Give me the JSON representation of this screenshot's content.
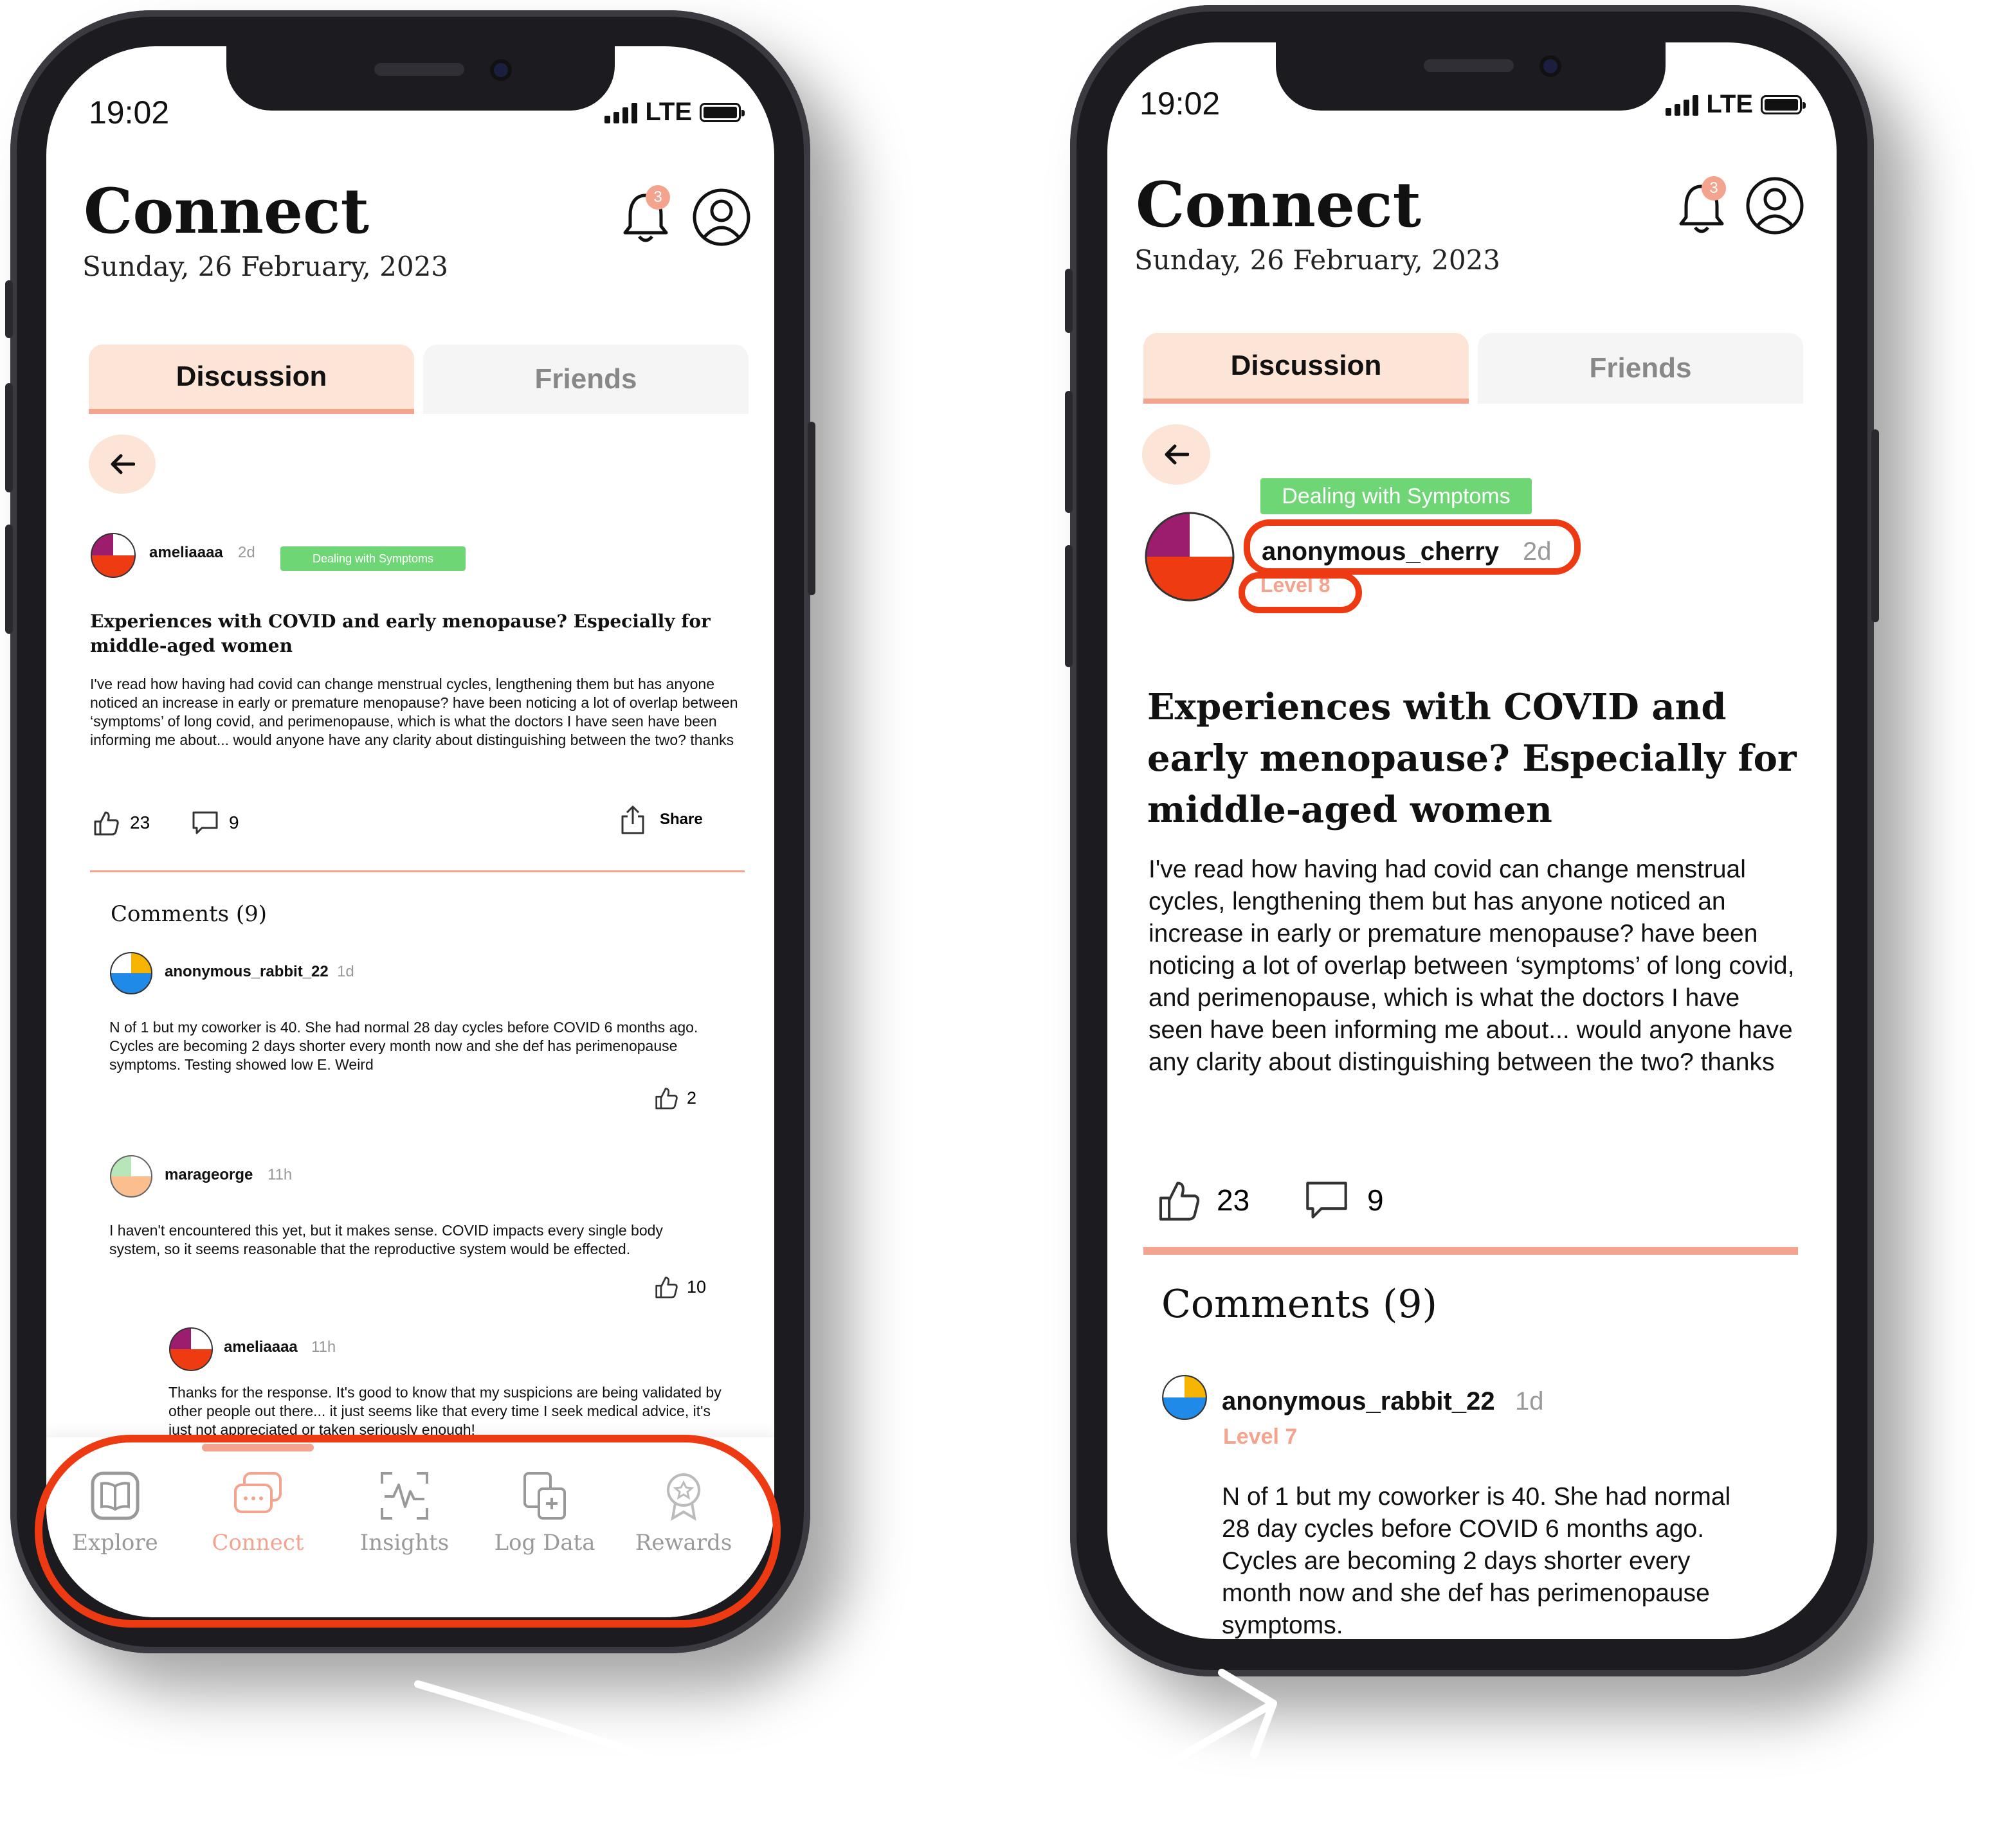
{
  "status": {
    "time": "19:02",
    "network": "LTE"
  },
  "header": {
    "title": "Connect",
    "date": "Sunday, 26 February, 2023",
    "notification_count": "3"
  },
  "tabs": [
    {
      "label": "Discussion",
      "active": true
    },
    {
      "label": "Friends",
      "active": false
    }
  ],
  "post": {
    "author_left": "ameliaaaa",
    "author_right": "anonymous_cherry",
    "age": "2d",
    "level": "Level 8",
    "tag": "Dealing with Symptoms",
    "title": "Experiences with COVID and early menopause? Especially for middle-aged women",
    "body": "I've read how having had covid can change menstrual cycles, lengthening them but has anyone noticed an increase in early or premature menopause? have been noticing a lot of overlap between ‘symptoms’ of long covid, and perimenopause, which is what the doctors I have seen have been informing me about... would anyone have any clarity about distinguishing between the two? thanks",
    "likes": "23",
    "comments": "9",
    "share_label": "Share"
  },
  "comments_header": "Comments (9)",
  "comments": [
    {
      "author": "anonymous_rabbit_22",
      "age": "1d",
      "level": "Level 7",
      "text": "N of 1 but my coworker is 40. She had normal 28 day cycles before COVID 6 months ago. Cycles are becoming 2 days shorter every month now and she def has perimenopause symptoms. Testing showed low E. Weird",
      "text_right": "N of 1 but my coworker is 40. She had normal 28 day cycles before COVID 6 months ago. Cycles are becoming 2 days shorter every month now and she def has perimenopause symptoms.",
      "likes": "2"
    },
    {
      "author": "marageorge",
      "age": "11h",
      "text": "I haven't encountered this yet, but it makes sense. COVID impacts every single body system, so it seems reasonable that the reproductive system would be effected.",
      "likes": "10"
    },
    {
      "author": "ameliaaaa",
      "age": "11h",
      "text": "Thanks for the response. It's good to know that my suspicions are being validated by other people out there... it just seems like that every time I seek medical advice, it's just not appreciated or taken seriously enough!"
    }
  ],
  "nav": [
    {
      "label": "Explore",
      "icon": "book-icon",
      "active": false
    },
    {
      "label": "Connect",
      "icon": "chat-bubbles-icon",
      "active": true
    },
    {
      "label": "Insights",
      "icon": "pulse-icon",
      "active": false
    },
    {
      "label": "Log Data",
      "icon": "add-document-icon",
      "active": false
    },
    {
      "label": "Rewards",
      "icon": "award-icon",
      "active": false
    }
  ],
  "colors": {
    "accent": "#f4a38f",
    "highlight": "#ee3a12",
    "tag": "#6fd676",
    "tab_active_bg": "#fce4d6"
  }
}
